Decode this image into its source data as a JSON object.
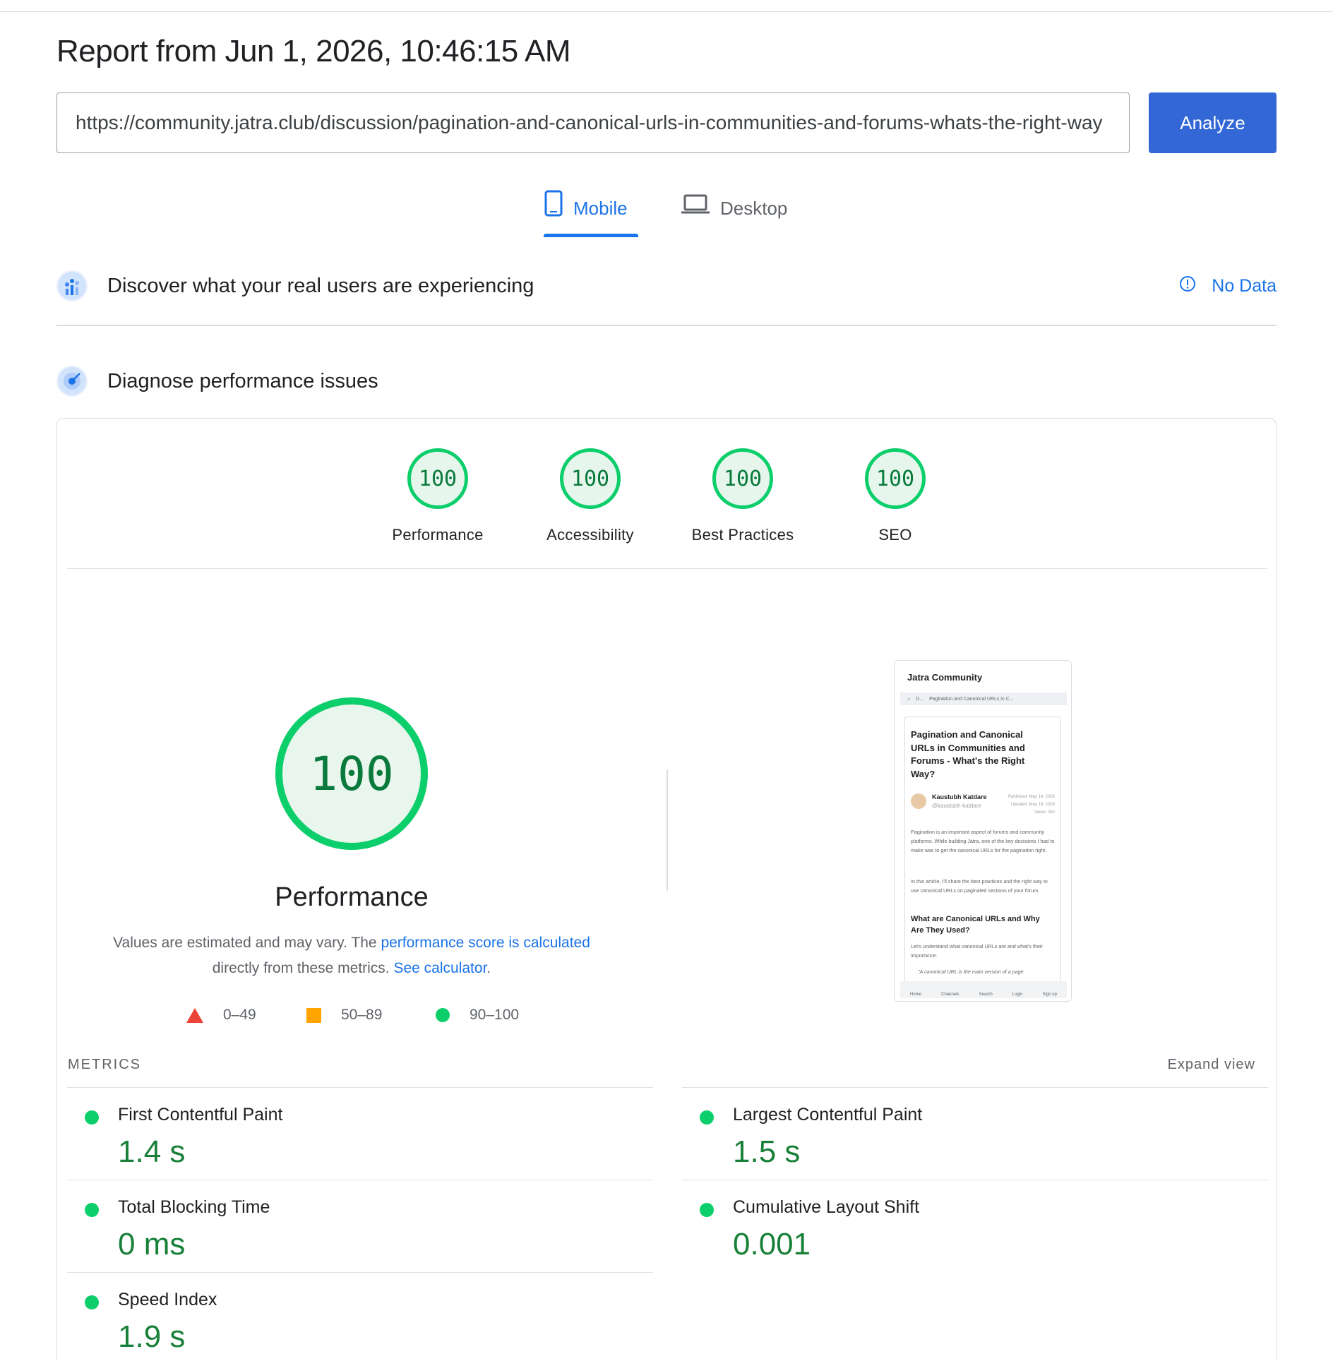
{
  "report": {
    "title": "Report from Jun 1, 2026, 10:46:15 AM"
  },
  "url_input": {
    "value": "https://community.jatra.club/discussion/pagination-and-canonical-urls-in-communities-and-forums-whats-the-right-way"
  },
  "analyze_label": "Analyze",
  "tabs": [
    {
      "label": "Mobile",
      "icon": "phone-icon",
      "active": true
    },
    {
      "label": "Desktop",
      "icon": "laptop-icon",
      "active": false
    }
  ],
  "field_data": {
    "title": "Discover what your real users are experiencing",
    "status": "No Data",
    "icon": "chart-people-icon"
  },
  "lab_data": {
    "title": "Diagnose performance issues",
    "icon": "target-icon"
  },
  "scores": [
    {
      "value": "100",
      "label": "Performance"
    },
    {
      "value": "100",
      "label": "Accessibility"
    },
    {
      "value": "100",
      "label": "Best Practices"
    },
    {
      "value": "100",
      "label": "SEO"
    }
  ],
  "main_score": {
    "value": "100",
    "label": "Performance",
    "desc_prefix": "Values are estimated and may vary. The ",
    "desc_link1": "performance score is calculated",
    "desc_middle": " directly from these metrics. ",
    "desc_link2": "See calculator",
    "desc_suffix": "."
  },
  "legend": {
    "poor": "0–49",
    "average": "50–89",
    "good": "90–100"
  },
  "colors": {
    "good": "#0cce6b",
    "average": "#ffa400",
    "poor": "#eb4335",
    "accent": "#1a73e8",
    "button": "#3367d6"
  },
  "preview": {
    "site_name": "Jatra Community",
    "crumb_short": "D...",
    "crumb_page": "Pagination and Canonical URLs in C...",
    "title": "Pagination and Canonical URLs in Communities and Forums - What's the Right Way?",
    "author": "Kaustubh Katdare",
    "handle": "@kaustubh-katdare",
    "published": "Published: May 14, 2026",
    "updated": "Updated: May 18, 2026",
    "views": "Views: 282",
    "para1": "Pagination is an important aspect of forums and community platforms. While building Jatra, one of the key decisions I had to make was to get the canonical URLs for the pagination right.",
    "para2": "In this article, I'll share the best practices and the right way to use canonical URLs on paginated sections of your forum.",
    "h2": "What are Canonical URLs and Why Are They Used?",
    "para3": "Let's understand what canonical URLs are and what's their importance.",
    "quote": "\"A canonical URL is the main version of a page",
    "nav": [
      "Home",
      "Channels",
      "Search",
      "Login",
      "Sign up"
    ]
  },
  "metrics": {
    "title": "METRICS",
    "expand": "Expand view",
    "items": [
      {
        "name": "First Contentful Paint",
        "value": "1.4 s"
      },
      {
        "name": "Largest Contentful Paint",
        "value": "1.5 s"
      },
      {
        "name": "Total Blocking Time",
        "value": "0 ms"
      },
      {
        "name": "Cumulative Layout Shift",
        "value": "0.001"
      },
      {
        "name": "Speed Index",
        "value": "1.9 s"
      }
    ]
  }
}
